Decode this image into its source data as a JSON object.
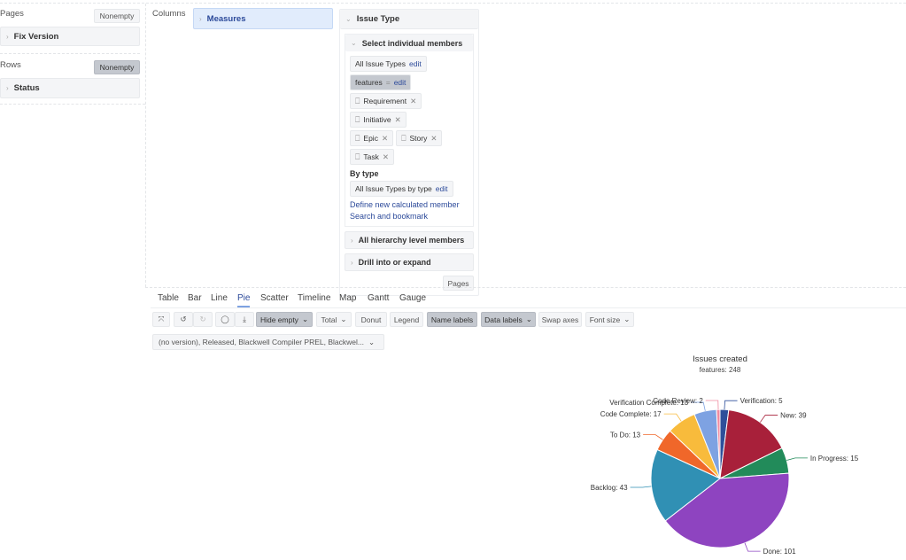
{
  "left": {
    "pages_label": "Pages",
    "pages_nonempty": "Nonempty",
    "pages_items": [
      "Fix Version"
    ],
    "rows_label": "Rows",
    "rows_nonempty": "Nonempty",
    "rows_items": [
      "Status"
    ]
  },
  "columns": {
    "label": "Columns",
    "items": [
      "Measures"
    ]
  },
  "issue_panel": {
    "title": "Issue Type",
    "section_select": "Select individual members",
    "all_chip": "All Issue Types",
    "edit": "edit",
    "features_chip": "features",
    "features_eq": "=",
    "members": [
      "Requirement",
      "Initiative",
      "Epic",
      "Story",
      "Task"
    ],
    "by_type_label": "By type",
    "by_type_chip": "All Issue Types by type",
    "link_define": "Define new calculated member",
    "link_search": "Search and bookmark",
    "section_hierarchy": "All hierarchy level members",
    "section_drill": "Drill into or expand",
    "pages_button": "Pages"
  },
  "tabs": [
    "Table",
    "Bar",
    "Line",
    "Pie",
    "Scatter",
    "Timeline",
    "Map",
    "Gantt",
    "Gauge"
  ],
  "active_tab": "Pie",
  "toolbar": {
    "hide_empty": "Hide empty",
    "total": "Total",
    "donut": "Donut",
    "legend": "Legend",
    "name_labels": "Name labels",
    "data_labels": "Data labels",
    "swap_axes": "Swap axes",
    "font_size": "Font size"
  },
  "filter": {
    "value": "(no version), Released, Blackwell Compiler PREL, Blackwel..."
  },
  "chart_data": {
    "type": "pie",
    "title": "Issues created",
    "subtitle": "features: 248",
    "slices": [
      {
        "name": "Verification",
        "value": 5,
        "color": "#2e4f9a"
      },
      {
        "name": "New",
        "value": 39,
        "color": "#a8203a"
      },
      {
        "name": "In Progress",
        "value": 15,
        "color": "#228b5a"
      },
      {
        "name": "Done",
        "value": 101,
        "color": "#8e44c0"
      },
      {
        "name": "Backlog",
        "value": 43,
        "color": "#3090b4"
      },
      {
        "name": "To Do",
        "value": 13,
        "color": "#f0672a"
      },
      {
        "name": "Code Complete",
        "value": 17,
        "color": "#f8bb3c"
      },
      {
        "name": "Verification Complete",
        "value": 13,
        "color": "#7ea2e2"
      },
      {
        "name": "Code Review",
        "value": 2,
        "color": "#f08aa0"
      }
    ]
  }
}
